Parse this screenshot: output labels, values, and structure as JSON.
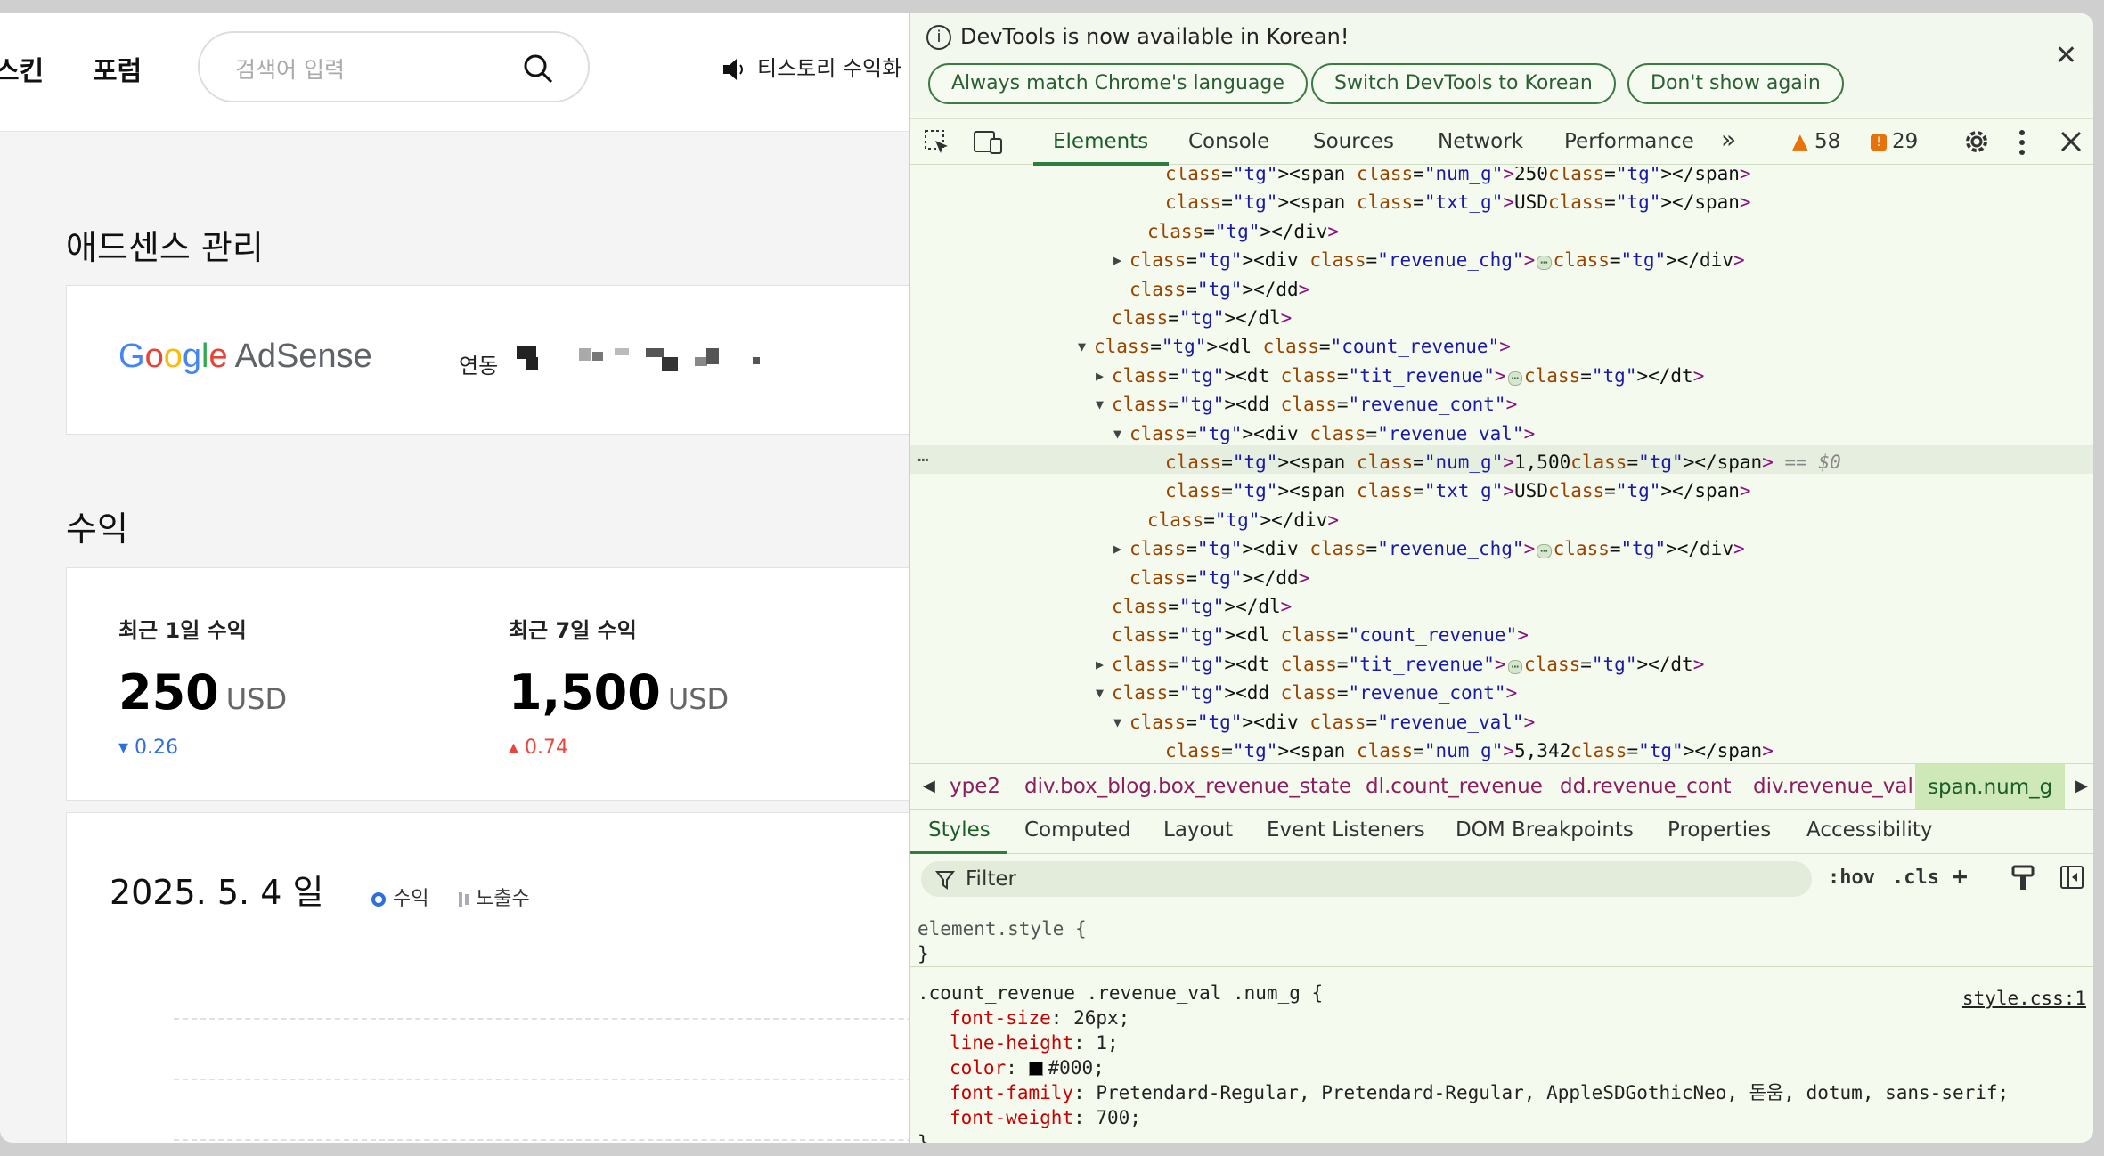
{
  "page": {
    "nav": {
      "skin": "스킨",
      "forum": "포럼"
    },
    "search": {
      "placeholder": "검색어 입력"
    },
    "notice": "티스토리 수익화",
    "adsense_section_title": "애드센스 관리",
    "adsense_logo": {
      "google": [
        "G",
        "o",
        "o",
        "g",
        "l",
        "e"
      ],
      "product": "AdSense"
    },
    "link_label": "연동",
    "revenue_section_title": "수익",
    "revenue": [
      {
        "label": "최근 1일 수익",
        "value": "250",
        "unit": "USD",
        "change": "▾ 0.26",
        "dir": "down"
      },
      {
        "label": "최근 7일 수익",
        "value": "1,500",
        "unit": "USD",
        "change": "▴ 0.74",
        "dir": "up"
      }
    ],
    "chart": {
      "date": "2025. 5. 4 일",
      "legend_revenue": "수익",
      "legend_views": "노출수"
    }
  },
  "devtools": {
    "info": {
      "message": "DevTools is now available in Korean!",
      "btn_match": "Always match Chrome's language",
      "btn_switch": "Switch DevTools to Korean",
      "btn_dont": "Don't show again"
    },
    "tabs": [
      "Elements",
      "Console",
      "Sources",
      "Network",
      "Performance"
    ],
    "more": "»",
    "warnings": "58",
    "errors": "29",
    "dom_lines": [
      {
        "indent": 14,
        "a": "",
        "t": "<span class=\"num_g\">250</span>"
      },
      {
        "indent": 14,
        "a": "",
        "t": "<span class=\"txt_g\">USD</span>"
      },
      {
        "indent": 13,
        "a": "",
        "t": "</div>"
      },
      {
        "indent": 12,
        "a": "▶",
        "t": "<div class=\"revenue_chg\"> ⋯ </div>"
      },
      {
        "indent": 12,
        "a": "",
        "t": "</dd>"
      },
      {
        "indent": 11,
        "a": "",
        "t": "</dl>"
      },
      {
        "indent": 10,
        "a": "▼",
        "t": "<dl class=\"count_revenue\">"
      },
      {
        "indent": 11,
        "a": "▶",
        "t": "<dt class=\"tit_revenue\"> ⋯ </dt>"
      },
      {
        "indent": 11,
        "a": "▼",
        "t": "<dd class=\"revenue_cont\">"
      },
      {
        "indent": 12,
        "a": "▼",
        "t": "<div class=\"revenue_val\">"
      },
      {
        "indent": 14,
        "a": "",
        "t": "<span class=\"num_g\">1,500</span> == $0"
      },
      {
        "indent": 14,
        "a": "",
        "t": "<span class=\"txt_g\">USD</span>"
      },
      {
        "indent": 13,
        "a": "",
        "t": "</div>"
      },
      {
        "indent": 12,
        "a": "▶",
        "t": "<div class=\"revenue_chg\"> ⋯ </div>"
      },
      {
        "indent": 12,
        "a": "",
        "t": "</dd>"
      },
      {
        "indent": 11,
        "a": "",
        "t": "</dl>"
      },
      {
        "indent": 11,
        "a": "",
        "t": "<dl class=\"count_revenue\">"
      },
      {
        "indent": 11,
        "a": "▶",
        "t": "<dt class=\"tit_revenue\"> ⋯ </dt>"
      },
      {
        "indent": 11,
        "a": "▼",
        "t": "<dd class=\"revenue_cont\">"
      },
      {
        "indent": 12,
        "a": "▼",
        "t": "<div class=\"revenue_val\">"
      },
      {
        "indent": 14,
        "a": "",
        "t": "<span class=\"num_g\">5,342</span>"
      }
    ],
    "selected_dots": "⋯",
    "crumbs": [
      "ype2",
      "div.box_blog.box_revenue_state",
      "dl.count_revenue",
      "dd.revenue_cont",
      "div.revenue_val",
      "span.num_g"
    ],
    "subtabs": [
      "Styles",
      "Computed",
      "Layout",
      "Event Listeners",
      "DOM Breakpoints",
      "Properties",
      "Accessibility"
    ],
    "filter_placeholder": "Filter",
    "hov": ":hov",
    "cls": ".cls",
    "styles": {
      "element_style": "element.style {",
      "close": "}",
      "selector": ".count_revenue .revenue_val .num_g {",
      "source": "style.css:1",
      "props": [
        {
          "name": "font-size",
          "value": "26px;"
        },
        {
          "name": "line-height",
          "value": "1;"
        },
        {
          "name": "color",
          "value": "#000;"
        },
        {
          "name": "font-family",
          "value": "Pretendard-Regular, Pretendard-Regular, AppleSDGothicNeo, 돋움, dotum, sans-serif;"
        },
        {
          "name": "font-weight",
          "value": "700;"
        }
      ]
    }
  }
}
